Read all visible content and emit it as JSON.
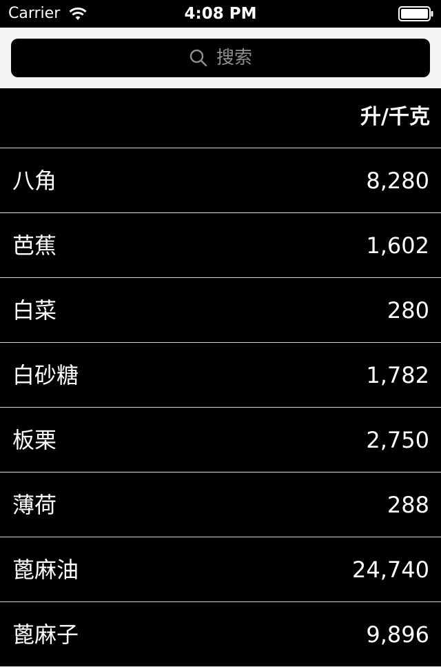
{
  "status_bar": {
    "carrier": "Carrier",
    "time": "4:08 PM",
    "wifi_icon": "wifi-icon",
    "battery_icon": "battery-icon"
  },
  "search": {
    "placeholder": "搜索",
    "icon": "search-icon"
  },
  "header": {
    "unit_label": "升/千克"
  },
  "rows": [
    {
      "name": "八角",
      "value": "8,280"
    },
    {
      "name": "芭蕉",
      "value": "1,602"
    },
    {
      "name": "白菜",
      "value": "280"
    },
    {
      "name": "白砂糖",
      "value": "1,782"
    },
    {
      "name": "板栗",
      "value": "2,750"
    },
    {
      "name": "薄荷",
      "value": "288"
    },
    {
      "name": "蓖麻油",
      "value": "24,740"
    },
    {
      "name": "蓖麻子",
      "value": "9,896"
    }
  ],
  "colors": {
    "background": "#000000",
    "search_bar_background": "#f4f4f4",
    "separator": "#d8d8d8",
    "text": "#ffffff",
    "placeholder": "#8e8e93"
  }
}
